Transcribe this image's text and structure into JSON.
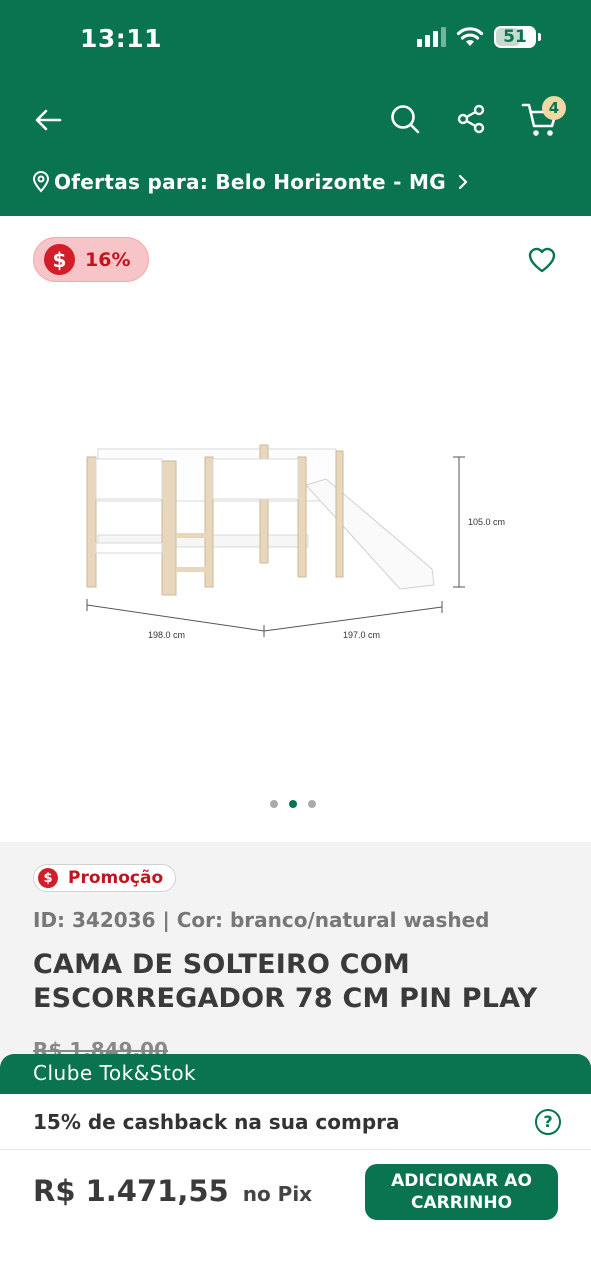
{
  "status_bar": {
    "time": "13:11",
    "battery": "51"
  },
  "header": {
    "cart_count": "4",
    "location_text": "Ofertas para: Belo Horizonte - MG"
  },
  "product": {
    "discount": "16%",
    "dimensions": {
      "height": "105.0 cm",
      "length": "198.0 cm",
      "width": "197.0 cm"
    },
    "carousel": {
      "count": 3,
      "active": 2
    },
    "promo_label": "Promoção",
    "id_line": "ID: 342036 | Cor: branco/natural washed",
    "title": "CAMA DE SOLTEIRO COM ESCORREGADOR 78 CM PIN PLAY",
    "old_price": "R$ 1.849,00"
  },
  "bottom_sheet": {
    "club_title": "Clube Tok&Stok",
    "cashback_text": "15% de cashback na sua compra",
    "pix_price": "R$ 1.471,55",
    "pix_suffix": "no Pix",
    "add_to_cart_label": "ADICIONAR AO CARRINHO"
  },
  "colors": {
    "brand": "#0a7451",
    "promo_red": "#d21d2b",
    "discount_bg": "#f7c4c8"
  },
  "icons": [
    "back-arrow-icon",
    "search-icon",
    "share-icon",
    "cart-icon",
    "location-pin-icon",
    "chevron-right-icon",
    "heart-icon",
    "dollar-icon",
    "help-icon"
  ]
}
